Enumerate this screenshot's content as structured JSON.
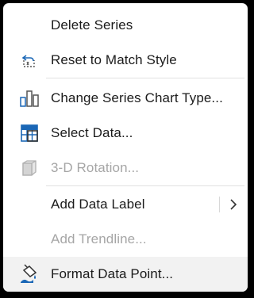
{
  "menu": {
    "items": [
      {
        "label": "Delete Series",
        "icon": "none",
        "enabled": true
      },
      {
        "label": "Reset to Match Style",
        "icon": "reset-style-icon",
        "enabled": true
      },
      {
        "label": "Change Series Chart Type...",
        "icon": "bar-chart-icon",
        "enabled": true
      },
      {
        "label": "Select Data...",
        "icon": "select-data-grid-icon",
        "enabled": true
      },
      {
        "label": "3-D Rotation...",
        "icon": "cube-3d-icon",
        "enabled": false
      },
      {
        "label": "Add Data Label",
        "icon": "none",
        "enabled": true,
        "has_submenu": true
      },
      {
        "label": "Add Trendline...",
        "icon": "none",
        "enabled": false
      },
      {
        "label": "Format Data Point...",
        "icon": "paint-bucket-icon",
        "enabled": true,
        "hovered": true
      }
    ]
  },
  "colors": {
    "accent_blue": "#1a67b6",
    "text": "#1b1b1b",
    "disabled_text": "#a6a6a6",
    "hover_background": "#f2f2f2"
  }
}
